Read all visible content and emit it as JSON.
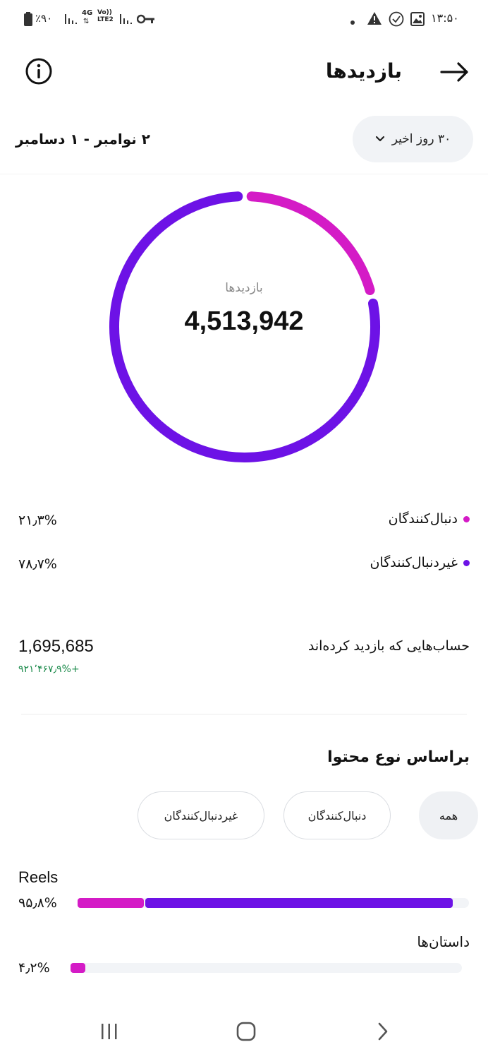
{
  "status_bar": {
    "battery": "٪۹۰",
    "network_4g": "4G",
    "network_volte": "Vo)) LTE2",
    "time": "۱۳:۵۰"
  },
  "header": {
    "title": "بازدیدها"
  },
  "range": {
    "selected": "۳۰ روز اخیر",
    "date_range": "۲ نوامبر - ۱ دسامبر"
  },
  "donut": {
    "center_label": "بازدیدها",
    "total": "4,513,942",
    "followers_fraction": 0.213,
    "non_followers_fraction": 0.787
  },
  "colors": {
    "followers": "#d41bc6",
    "non_followers": "#6d12e6",
    "positive": "#1a8a4a"
  },
  "legend": [
    {
      "label": "دنبال‌کنندگان",
      "value": "۲۱٫۳%"
    },
    {
      "label": "غیردنبال‌کنندگان",
      "value": "۷۸٫۷%"
    }
  ],
  "accounts": {
    "label": "حساب‌هایی که بازدید کرده‌اند",
    "value": "1,695,685",
    "change": "+۹۲۱٬۴۶۷٫۹%"
  },
  "content_type": {
    "title": "براساس نوع محتوا",
    "filters": [
      "همه",
      "دنبال‌کنندگان",
      "غیردنبال‌کنندگان"
    ],
    "rows": [
      {
        "name": "Reels",
        "value": "۹۵٫۸%",
        "total_fraction": 0.958,
        "followers_fraction": 0.18
      },
      {
        "name": "داستان‌ها",
        "value": "۴٫۲%",
        "total_fraction": 0.042,
        "followers_fraction": 1.0
      }
    ]
  }
}
